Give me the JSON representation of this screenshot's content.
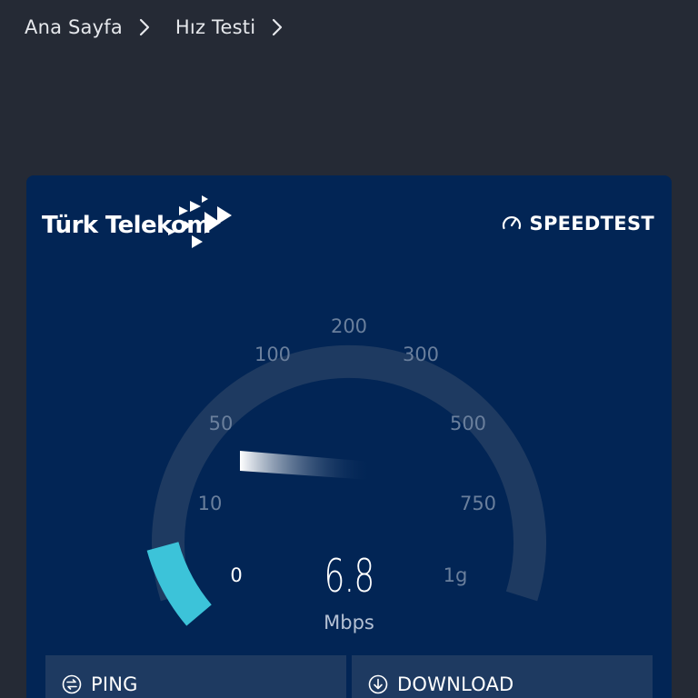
{
  "breadcrumb": {
    "items": [
      {
        "label": "Ana Sayfa"
      },
      {
        "label": "Hız Testi"
      }
    ]
  },
  "card": {
    "brand": "Türk Telekom",
    "provider": "SPEEDTEST",
    "gauge": {
      "ticks": [
        "0",
        "10",
        "50",
        "100",
        "200",
        "300",
        "500",
        "750",
        "1g"
      ],
      "speed": "6.8",
      "unit": "Mbps",
      "fill_fraction": 0.09,
      "colors": {
        "track": "#1e3a61",
        "fill": "#3cc3d9",
        "card": "#022555"
      }
    },
    "panels": {
      "ping": {
        "label": "PING",
        "icon": "ping-icon"
      },
      "download": {
        "label": "DOWNLOAD",
        "icon": "download-icon"
      }
    }
  }
}
